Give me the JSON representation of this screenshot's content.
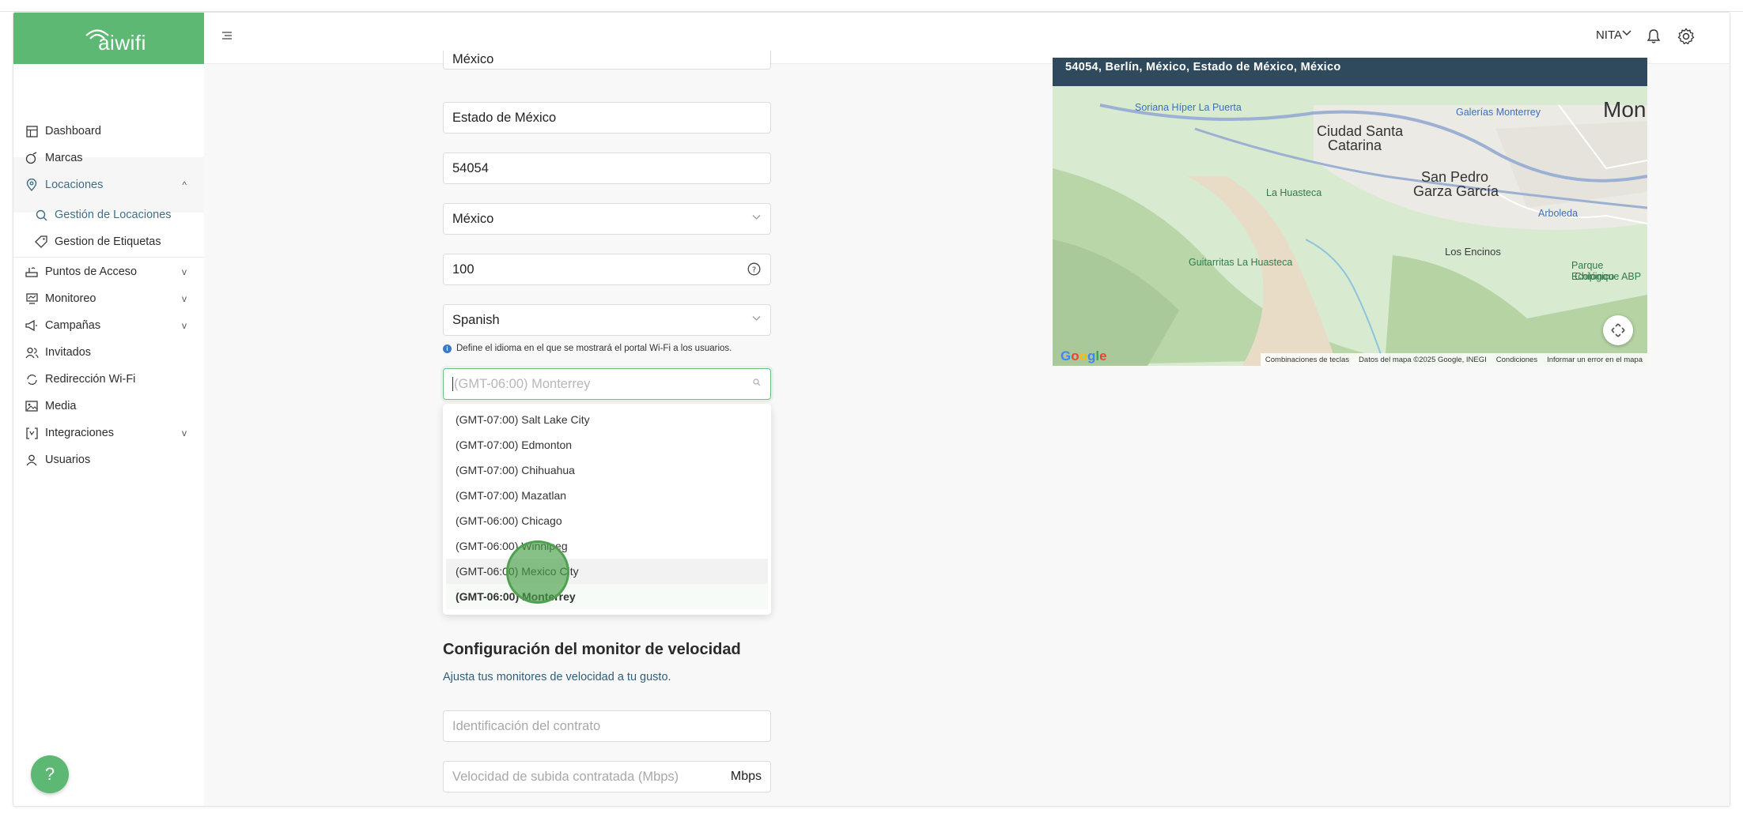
{
  "brand": {
    "name": "aiwifi",
    "color": "#5cb872"
  },
  "sidebar": {
    "items": [
      {
        "label": "Dashboard",
        "icon": "dashboard-icon"
      },
      {
        "label": "Marcas",
        "icon": "tag-icon"
      },
      {
        "label": "Locaciones",
        "icon": "location-pin-icon",
        "expanded": true
      },
      {
        "label": "Gestión de Locaciones",
        "icon": "location-search-icon",
        "active": true
      },
      {
        "label": "Gestion de Etiquetas",
        "icon": "label-icon"
      },
      {
        "label": "Puntos de Acceso",
        "icon": "router-icon"
      },
      {
        "label": "Monitoreo",
        "icon": "monitor-icon"
      },
      {
        "label": "Campañas",
        "icon": "megaphone-icon"
      },
      {
        "label": "Invitados",
        "icon": "users-icon"
      },
      {
        "label": "Redirección Wi-Fi",
        "icon": "redirect-icon"
      },
      {
        "label": "Media",
        "icon": "media-icon"
      },
      {
        "label": "Integraciones",
        "icon": "integrations-icon"
      },
      {
        "label": "Usuarios",
        "icon": "user-icon"
      }
    ]
  },
  "header": {
    "user": "NITA"
  },
  "form": {
    "country_top": "México",
    "state": "Estado de México",
    "postal_code": "54054",
    "country": "México",
    "radius": "100",
    "language": "Spanish",
    "language_hint": "Define el idioma en el que se mostrará el portal Wi-Fi a los usuarios.",
    "timezone_placeholder": "(GMT-06:00) Monterrey",
    "timezone_options": [
      "(GMT-07:00) Salt Lake City",
      "(GMT-07:00) Edmonton",
      "(GMT-07:00) Chihuahua",
      "(GMT-07:00) Mazatlan",
      "(GMT-06:00) Chicago",
      "(GMT-06:00) Winnipeg",
      "(GMT-06:00) Mexico City",
      "(GMT-06:00) Monterrey"
    ],
    "timezone_hovered": "(GMT-06:00) Mexico City",
    "timezone_selected": "(GMT-06:00) Monterrey"
  },
  "speed": {
    "title": "Configuración del monitor de velocidad",
    "subtitle": "Ajusta tus monitores de velocidad a tu gusto.",
    "contract_placeholder": "Identificación del contrato",
    "upload_placeholder": "Velocidad de subida contratada (Mbps)",
    "upload_unit": "Mbps"
  },
  "map": {
    "address": "54054, Berlín, México, Estado de México, México",
    "labels": {
      "soriana": "Soriana Híper La Puerta",
      "galerias": "Galerías Monterrey",
      "mon": "Mon",
      "ciudad_santa": "Ciudad Santa",
      "catarina": "Catarina",
      "san_pedro": "San Pedro",
      "garza_garcia": "Garza García",
      "la_huasteca": "La Huasteca",
      "arboleda": "Arboleda",
      "los_encinos": "Los Encinos",
      "guitarritas": "Guitarritas La Huasteca",
      "parque": "Parque Ecológico",
      "chipinque": "Chipinque ABP"
    },
    "footer": {
      "shortcuts": "Combinaciones de teclas",
      "data": "Datos del mapa ©2025 Google, INEGI",
      "terms": "Condiciones",
      "report": "Informar un error en el mapa"
    },
    "google": "Google"
  },
  "help_fab": "?"
}
